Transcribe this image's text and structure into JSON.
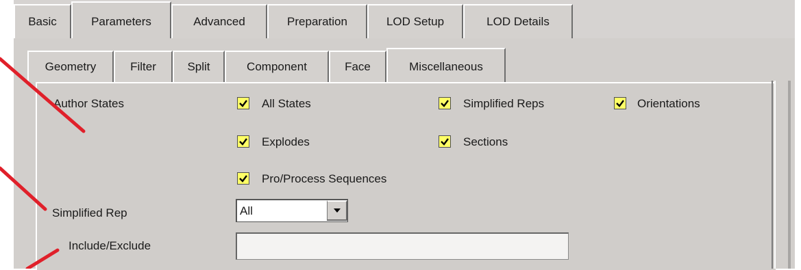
{
  "outer_tabs": [
    {
      "label": "Basic",
      "active": false
    },
    {
      "label": "Parameters",
      "active": true
    },
    {
      "label": "Advanced",
      "active": false
    },
    {
      "label": "Preparation",
      "active": false
    },
    {
      "label": "LOD Setup",
      "active": false
    },
    {
      "label": "LOD Details",
      "active": false
    }
  ],
  "inner_tabs": [
    {
      "label": "Geometry",
      "active": false
    },
    {
      "label": "Filter",
      "active": false
    },
    {
      "label": "Split",
      "active": false
    },
    {
      "label": "Component",
      "active": false
    },
    {
      "label": "Face",
      "active": false
    },
    {
      "label": "Miscellaneous",
      "active": true
    }
  ],
  "author_states": {
    "label": "Author States",
    "options": [
      {
        "label": "All States",
        "checked": true
      },
      {
        "label": "Simplified Reps",
        "checked": true
      },
      {
        "label": "Orientations",
        "checked": true
      },
      {
        "label": "Explodes",
        "checked": true
      },
      {
        "label": "Sections",
        "checked": true
      },
      {
        "label": "Pro/Process Sequences",
        "checked": true
      }
    ]
  },
  "simplified_rep": {
    "label": "Simplified Rep",
    "value": "All"
  },
  "include_exclude": {
    "label": "Include/Exclude",
    "value": ""
  },
  "colors": {
    "checkbox_fill": "#ffff66",
    "annotation_arrow": "#e0202a"
  }
}
